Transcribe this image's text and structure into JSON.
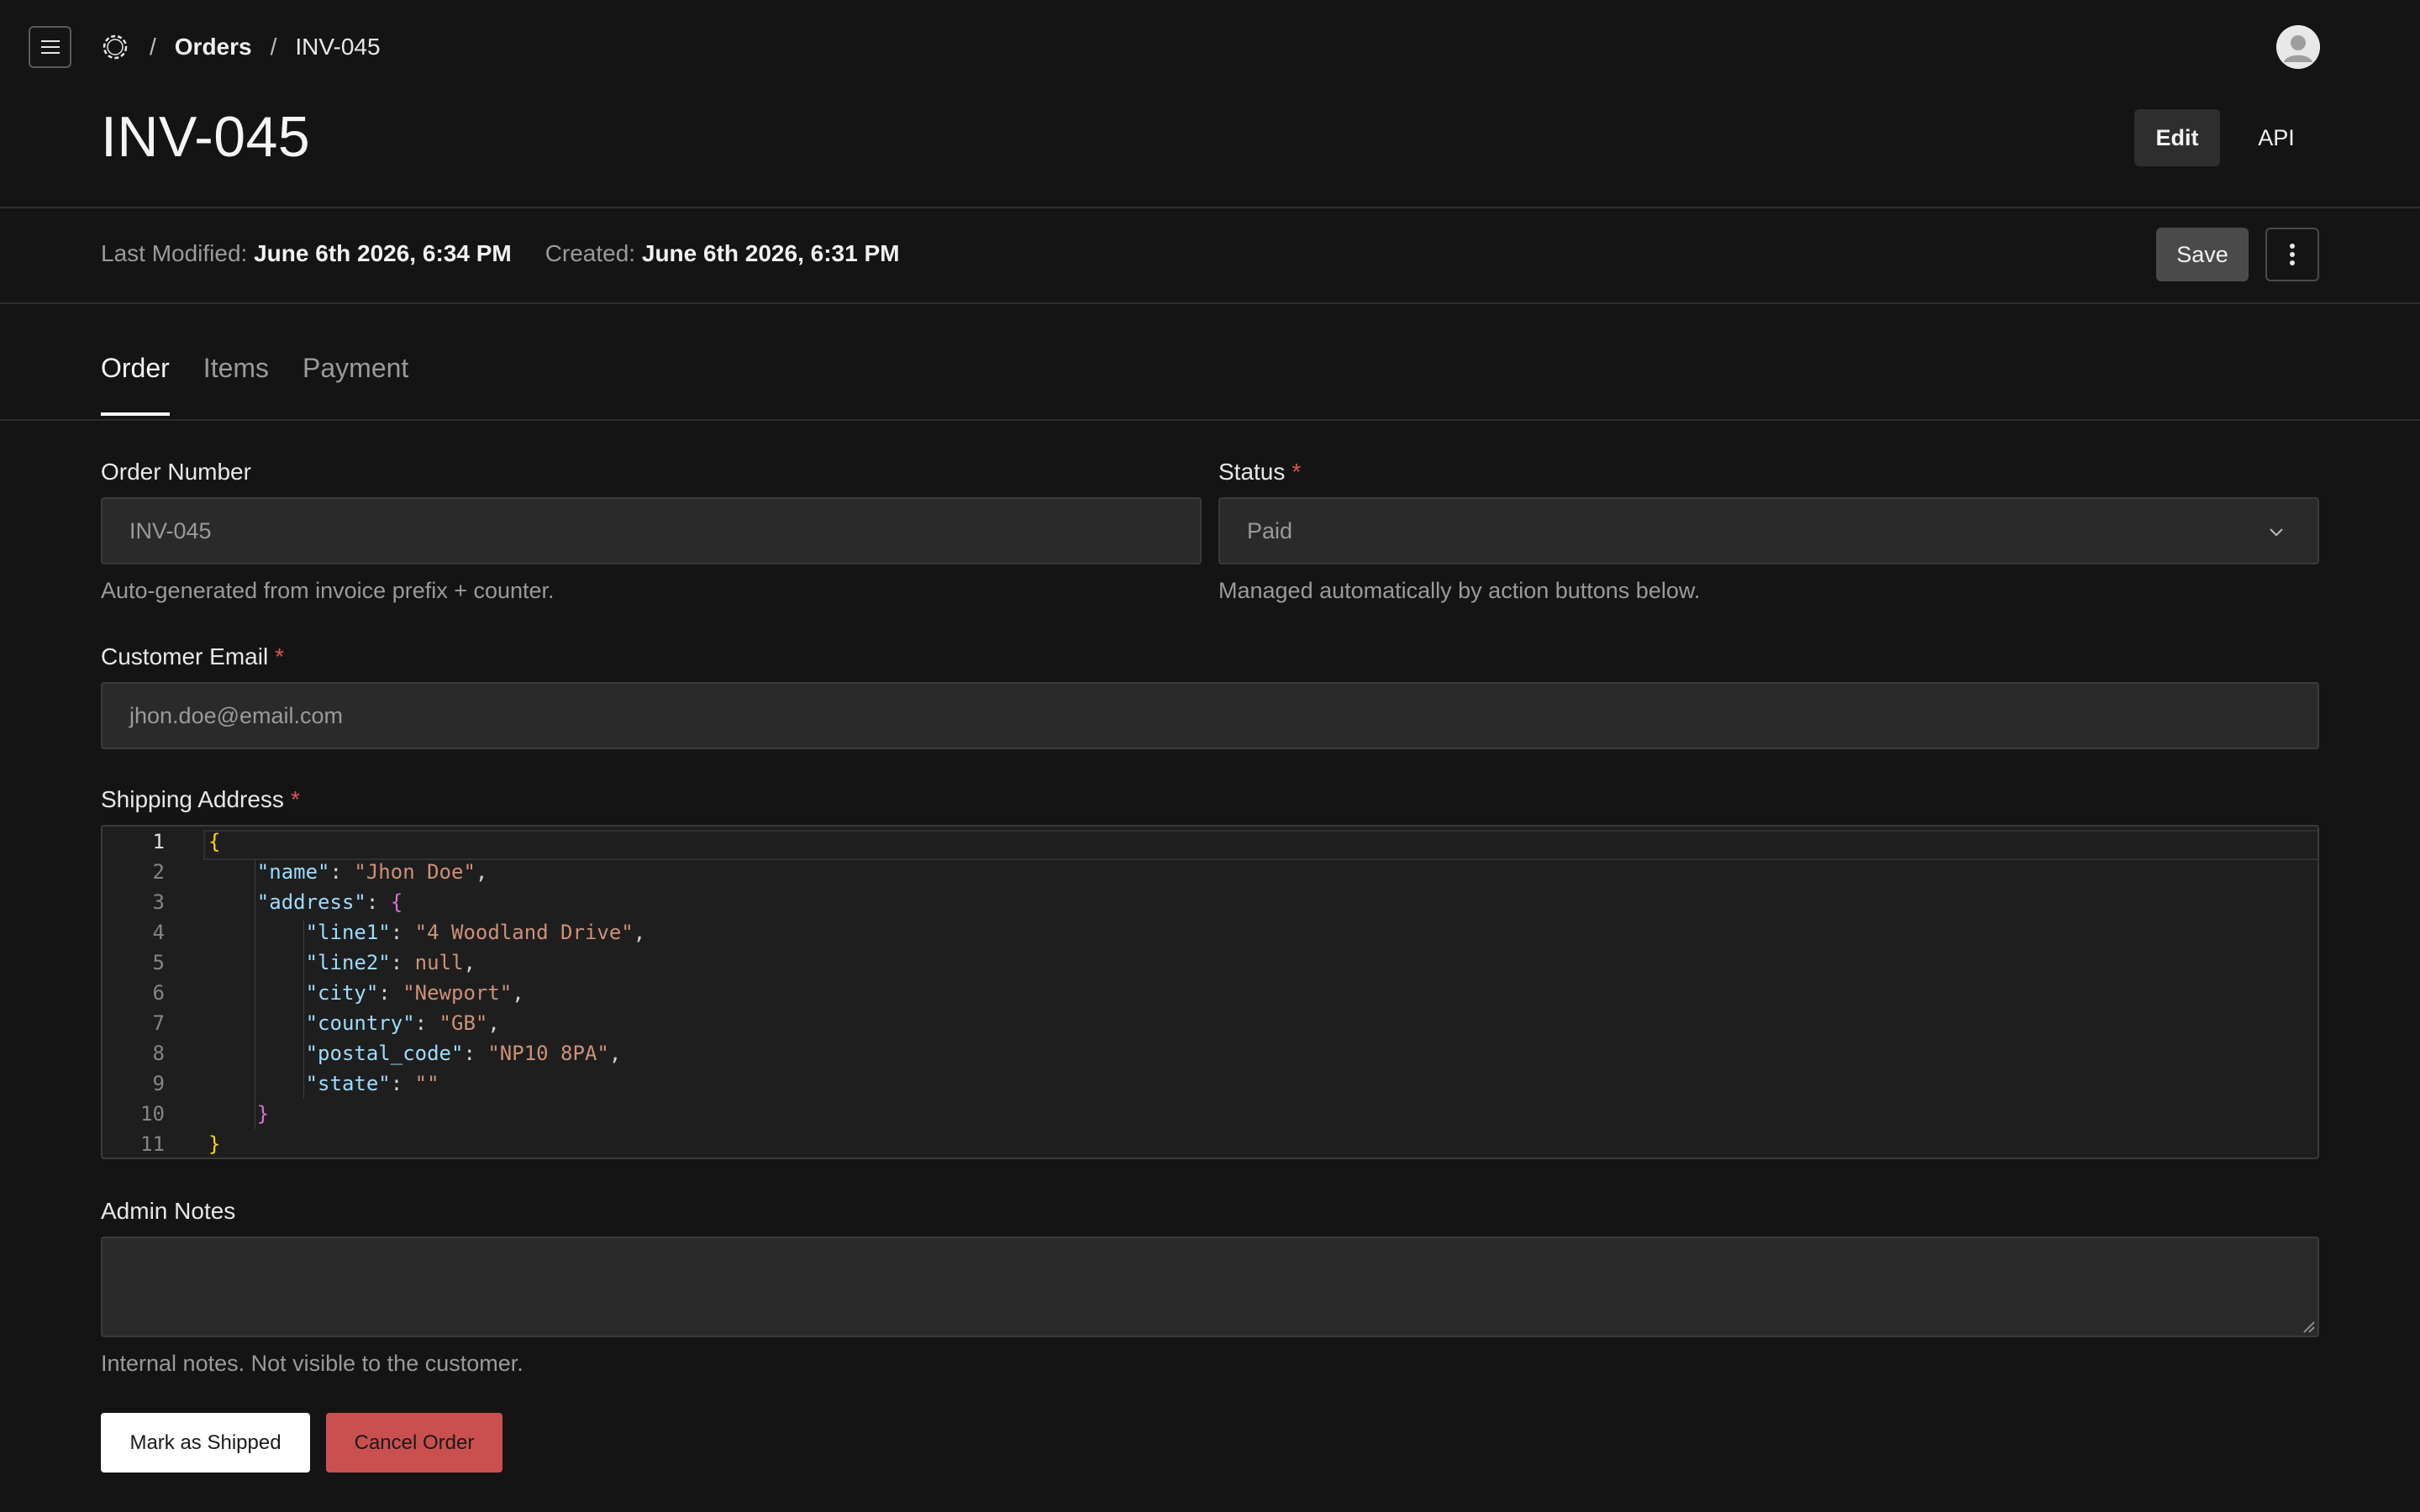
{
  "breadcrumb": {
    "section": "Orders",
    "current": "INV-045"
  },
  "page": {
    "title": "INV-045"
  },
  "header_actions": {
    "edit_label": "Edit",
    "api_label": "API"
  },
  "meta": {
    "modified_label": "Last Modified:",
    "modified_value": "June 6th 2026, 6:34 PM",
    "created_label": "Created:",
    "created_value": "June 6th 2026, 6:31 PM",
    "save_label": "Save"
  },
  "tabs": [
    {
      "label": "Order",
      "active": true
    },
    {
      "label": "Items",
      "active": false
    },
    {
      "label": "Payment",
      "active": false
    }
  ],
  "form": {
    "order_number": {
      "label": "Order Number",
      "value": "INV-045",
      "help": "Auto-generated from invoice prefix + counter."
    },
    "status": {
      "label": "Status",
      "required_mark": "*",
      "value": "Paid",
      "help": "Managed automatically by action buttons below."
    },
    "customer_email": {
      "label": "Customer Email",
      "required_mark": "*",
      "value": "jhon.doe@email.com"
    },
    "shipping_address": {
      "label": "Shipping Address",
      "required_mark": "*"
    },
    "admin_notes": {
      "label": "Admin Notes",
      "value": "",
      "help": "Internal notes. Not visible to the customer."
    }
  },
  "editor": {
    "line_numbers": [
      "1",
      "2",
      "3",
      "4",
      "5",
      "6",
      "7",
      "8",
      "9",
      "10",
      "11"
    ],
    "tokens": {
      "open": "{",
      "close": "}",
      "k_name": "\"name\"",
      "v_name": "\"Jhon Doe\"",
      "k_address": "\"address\"",
      "addr_open": "{",
      "k_line1": "\"line1\"",
      "v_line1": "\"4 Woodland Drive\"",
      "k_line2": "\"line2\"",
      "v_line2": "null",
      "k_city": "\"city\"",
      "v_city": "\"Newport\"",
      "k_country": "\"country\"",
      "v_country": "\"GB\"",
      "k_postal": "\"postal_code\"",
      "v_postal": "\"NP10 8PA\"",
      "k_state": "\"state\"",
      "v_state": "\"\"",
      "addr_close": "}"
    }
  },
  "actions": {
    "ship_label": "Mark as Shipped",
    "cancel_label": "Cancel Order"
  },
  "colors": {
    "background": "#141414",
    "danger": "#c9504f",
    "required": "#e05252",
    "json_key": "#9cdcfe",
    "json_string": "#ce9178"
  }
}
